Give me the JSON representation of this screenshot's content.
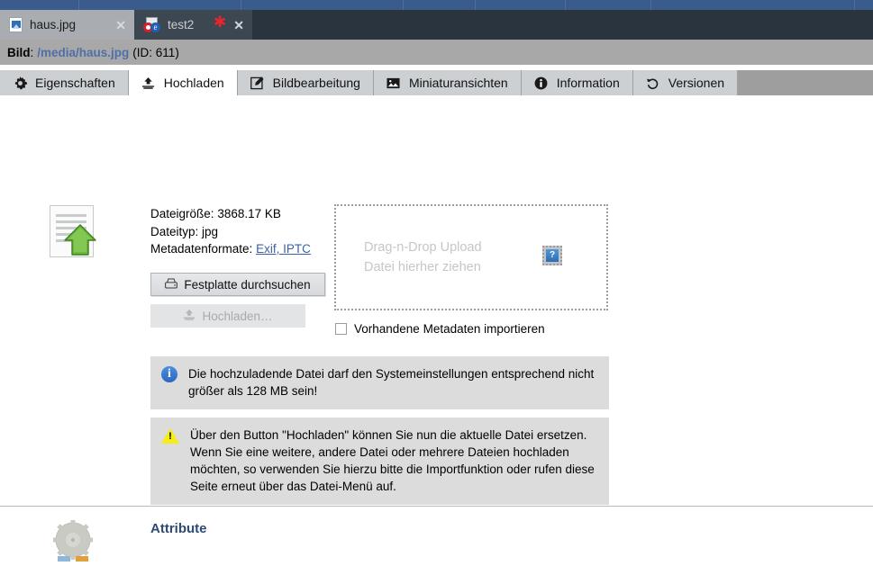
{
  "menu_strip": {
    "segment_widths": [
      88,
      180,
      180,
      80,
      100,
      95,
      226
    ]
  },
  "doc_tabs": [
    {
      "title": "haus.jpg",
      "icon": "image-file-icon",
      "close": "✕",
      "active": false,
      "dirty": false
    },
    {
      "title": "test2",
      "icon": "office-doc-icon",
      "close": "✕",
      "active": true,
      "dirty": true,
      "dirty_mark": "✱"
    }
  ],
  "crumb": {
    "label": "Bild",
    "colon": ":",
    "path": "/media/haus.jpg",
    "id_text": "(ID: 611)"
  },
  "nav_tabs": [
    {
      "label": "Eigenschaften",
      "icon": "gear-icon",
      "current": false
    },
    {
      "label": "Hochladen",
      "icon": "upload-icon",
      "current": true
    },
    {
      "label": "Bildbearbeitung",
      "icon": "edit-pencil-icon",
      "current": false
    },
    {
      "label": "Miniaturansichten",
      "icon": "picture-icon",
      "current": false
    },
    {
      "label": "Information",
      "icon": "info-icon",
      "current": false
    },
    {
      "label": "Versionen",
      "icon": "history-icon",
      "current": false
    }
  ],
  "upload_panel": {
    "big_icon": "document-upload-icon",
    "meta": {
      "filesize_label": "Dateigröße:",
      "filesize_value": "3868.17 KB",
      "filetype_label": "Dateityp:",
      "filetype_value": "jpg",
      "metaformats_label": "Metadatenformate:",
      "metaformats_link": "Exif, IPTC"
    },
    "browse_button": "Festplatte durchsuchen",
    "browse_icon": "drive-icon",
    "upload_button": "Hochladen…",
    "upload_button_icon": "upload-icon",
    "dropzone_line1": "Drag-n-Drop Upload",
    "dropzone_line2": "Datei hierher ziehen",
    "dropzone_help_icon": "help-question-icon",
    "dropzone_help_glyph": "?",
    "import_metadata_label": "Vorhandene Metadaten importieren",
    "import_metadata_checked": false
  },
  "messages": [
    {
      "kind": "info",
      "icon": "info-icon",
      "glyph": "i",
      "text": "Die hochzuladende Datei darf den Systemeinstellungen entsprechend nicht größer als 128 MB sein!"
    },
    {
      "kind": "warning",
      "icon": "warning-triangle-icon",
      "glyph": "!",
      "text": "Über den Button \"Hochladen\" können Sie nun die aktuelle Datei ersetzen. Wenn Sie eine weitere, andere Datei oder mehrere Dateien hochladen möchten, so verwenden Sie hierzu bitte die Importfunktion oder rufen diese Seite erneut über das Datei-Menü auf."
    }
  ],
  "attributes_section": {
    "icon": "gear-cog-icon",
    "title": "Attribute"
  },
  "colors": {
    "menu_strip": "#3a5c8c",
    "tab_bar": "#29343f",
    "tab_active": "#3d4752",
    "tab_inactive": "#a9adb2",
    "crumb_bar": "#a8a8a8",
    "nav_bar": "#9e9e9e",
    "nav_tab": "#cdd0d3",
    "nav_tab_current": "#ffffff",
    "link": "#3a61a8",
    "crumb_path": "#4f6fa8",
    "message_bg": "#dcdcdc",
    "accent_title": "#2c4a73",
    "dirty_mark": "#e8262a"
  }
}
